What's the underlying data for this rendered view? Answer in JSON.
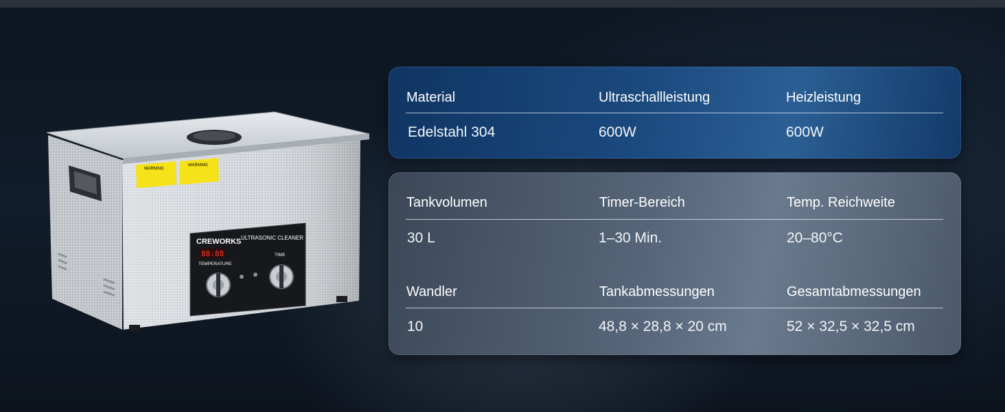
{
  "product": {
    "brand": "CREWORKS",
    "model_label": "ULTRASONIC CLEANER",
    "display_value": "88:88",
    "temperature_label": "TEMPERATURE",
    "time_label": "TIME",
    "warning_label": "WARNING"
  },
  "specs": {
    "top": [
      {
        "label": "Material",
        "value": "Edelstahl 304"
      },
      {
        "label": "Ultraschallleistung",
        "value": "600W"
      },
      {
        "label": "Heizleistung",
        "value": "600W"
      }
    ],
    "bottom_row1": [
      {
        "label": "Tankvolumen",
        "value": "30 L"
      },
      {
        "label": "Timer-Bereich",
        "value": "1–30 Min."
      },
      {
        "label": "Temp. Reichweite",
        "value": "20–80°C"
      }
    ],
    "bottom_row2": [
      {
        "label": "Wandler",
        "value": "10"
      },
      {
        "label": "Tankabmessungen",
        "value": "48,8 × 28,8 × 20 cm"
      },
      {
        "label": "Gesamtabmessungen",
        "value": "52 × 32,5 × 32,5 cm"
      }
    ]
  },
  "colors": {
    "top_panel": "#1b4a7f",
    "bottom_panel": "#566579",
    "background": "#111c2a"
  }
}
